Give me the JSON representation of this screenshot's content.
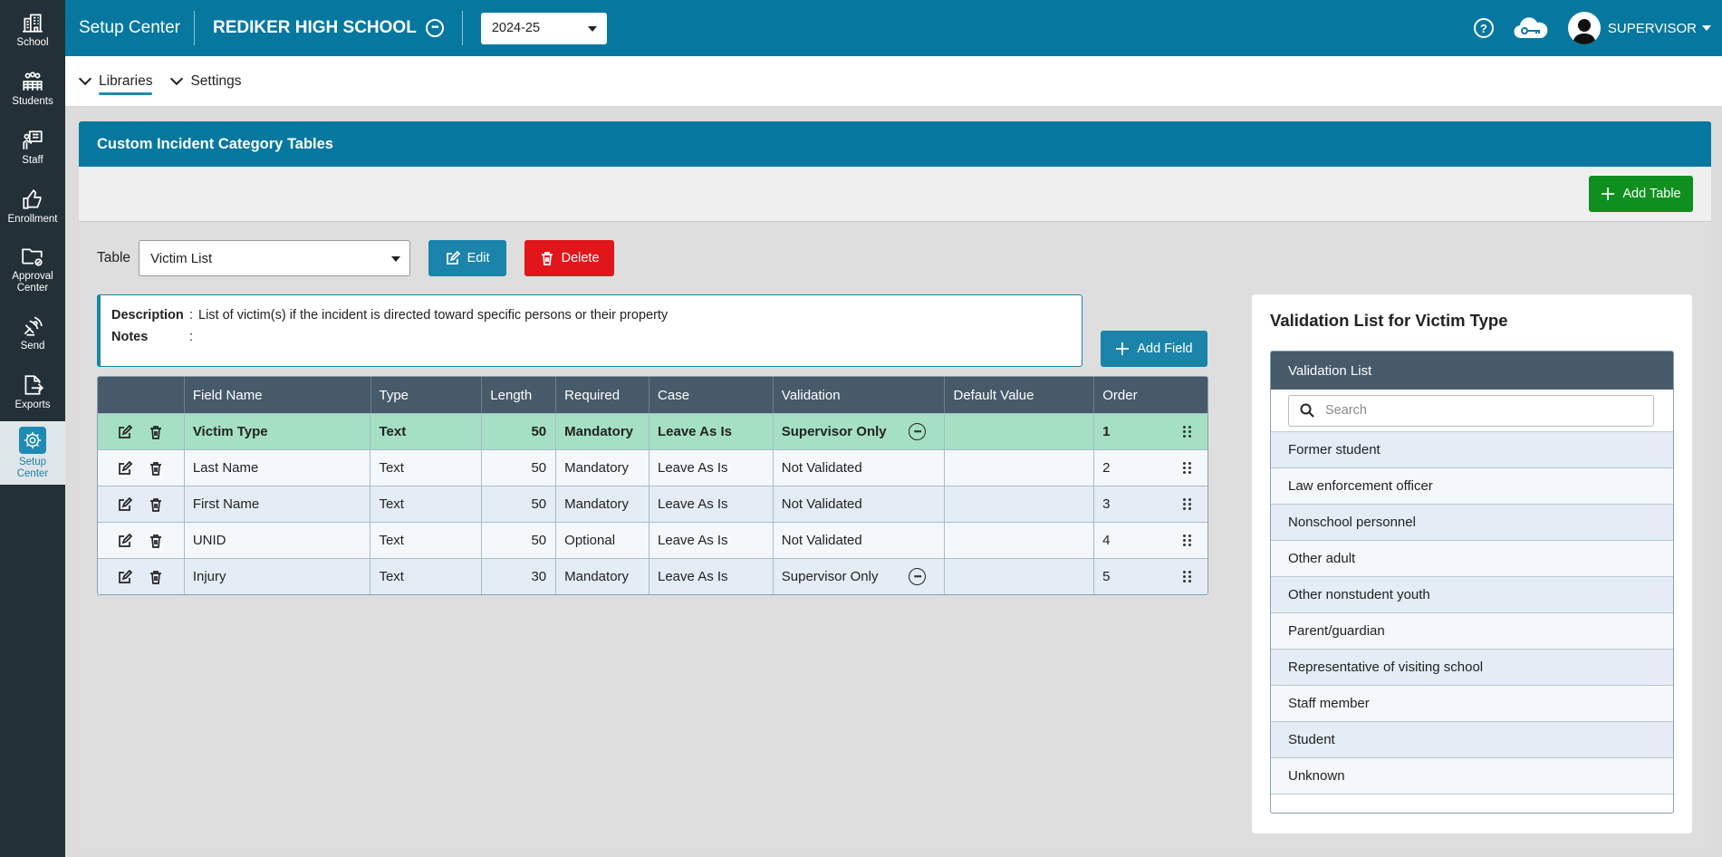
{
  "rail": [
    {
      "label": "School",
      "icon": "school-icon"
    },
    {
      "label": "Students",
      "icon": "students-icon"
    },
    {
      "label": "Staff",
      "icon": "staff-icon"
    },
    {
      "label": "Enrollment",
      "icon": "enrollment-icon"
    },
    {
      "label": "Approval Center",
      "icon": "approval-icon"
    },
    {
      "label": "Send",
      "icon": "send-icon"
    },
    {
      "label": "Exports",
      "icon": "exports-icon"
    },
    {
      "label": "Setup Center",
      "icon": "gear-icon",
      "active": true
    }
  ],
  "topbar": {
    "app_title": "Setup Center",
    "school": "REDIKER HIGH SCHOOL",
    "year": "2024-25",
    "user": "SUPERVISOR"
  },
  "subnav": [
    {
      "label": "Libraries",
      "active": true
    },
    {
      "label": "Settings",
      "active": false
    }
  ],
  "panel": {
    "title": "Custom Incident Category Tables",
    "add_table": "Add Table",
    "table_label": "Table",
    "table_value": "Victim List",
    "edit": "Edit",
    "delete": "Delete",
    "description_key": "Description",
    "description": "List of victim(s) if the incident is directed toward specific persons or their property",
    "notes_key": "Notes",
    "notes": "",
    "colon": ":",
    "add_field": "Add Field"
  },
  "grid": {
    "columns": [
      "",
      "Field Name",
      "Type",
      "Length",
      "Required",
      "Case",
      "Validation",
      "Default Value",
      "Order"
    ],
    "rows": [
      {
        "name": "Victim Type",
        "type": "Text",
        "length": "50",
        "required": "Mandatory",
        "case": "Leave As Is",
        "validation": "Supervisor Only",
        "has_more": true,
        "default": "",
        "order": "1",
        "selected": true
      },
      {
        "name": "Last Name",
        "type": "Text",
        "length": "50",
        "required": "Mandatory",
        "case": "Leave As Is",
        "validation": "Not Validated",
        "has_more": false,
        "default": "",
        "order": "2"
      },
      {
        "name": "First Name",
        "type": "Text",
        "length": "50",
        "required": "Mandatory",
        "case": "Leave As Is",
        "validation": "Not Validated",
        "has_more": false,
        "default": "",
        "order": "3"
      },
      {
        "name": "UNID",
        "type": "Text",
        "length": "50",
        "required": "Optional",
        "case": "Leave As Is",
        "validation": "Not Validated",
        "has_more": false,
        "default": "",
        "order": "4"
      },
      {
        "name": "Injury",
        "type": "Text",
        "length": "30",
        "required": "Mandatory",
        "case": "Leave As Is",
        "validation": "Supervisor Only",
        "has_more": true,
        "default": "",
        "order": "5"
      }
    ]
  },
  "validation": {
    "title": "Validation List for Victim Type",
    "header": "Validation List",
    "search_placeholder": "Search",
    "items": [
      "Former student",
      "Law enforcement officer",
      "Nonschool personnel",
      "Other adult",
      "Other nonstudent youth",
      "Parent/guardian",
      "Representative of visiting school",
      "Staff member",
      "Student",
      "Unknown"
    ]
  },
  "colors": {
    "brand": "#06789f",
    "add": "#0e8f1e",
    "delete": "#e0161b",
    "selected_row": "#a5e0c5"
  }
}
